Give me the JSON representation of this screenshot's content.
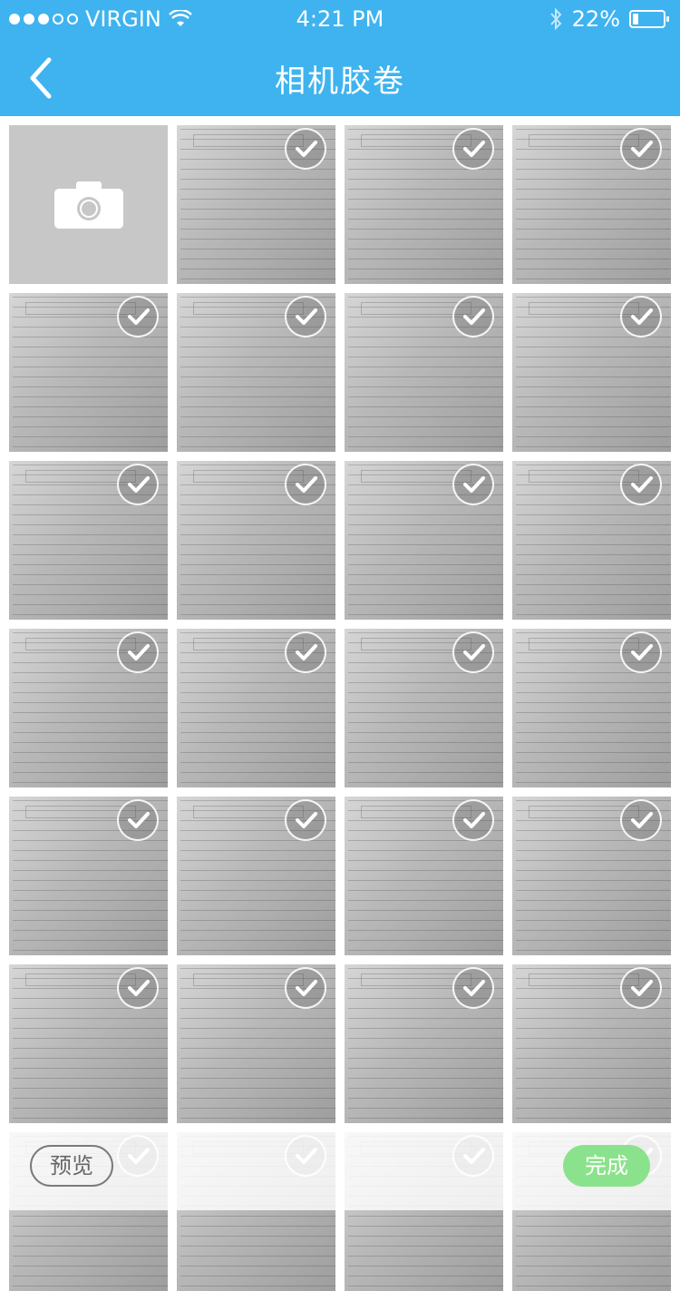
{
  "status_bar": {
    "carrier": "VIRGIN",
    "time": "4:21 PM",
    "battery": "22%",
    "signal_dots_filled": 3,
    "signal_dots_total": 5,
    "battery_level": 0.22
  },
  "navbar": {
    "title": "相机胶卷",
    "back_icon": "chevron-left-icon",
    "background": "#3fb3f0"
  },
  "grid": {
    "camera_icon": "camera-icon",
    "photos_selected_count": 27,
    "selected_icon": "checkmark-icon"
  },
  "bottom_bar": {
    "preview_label": "预览",
    "done_label": "完成",
    "done_color": "#8be28c"
  }
}
